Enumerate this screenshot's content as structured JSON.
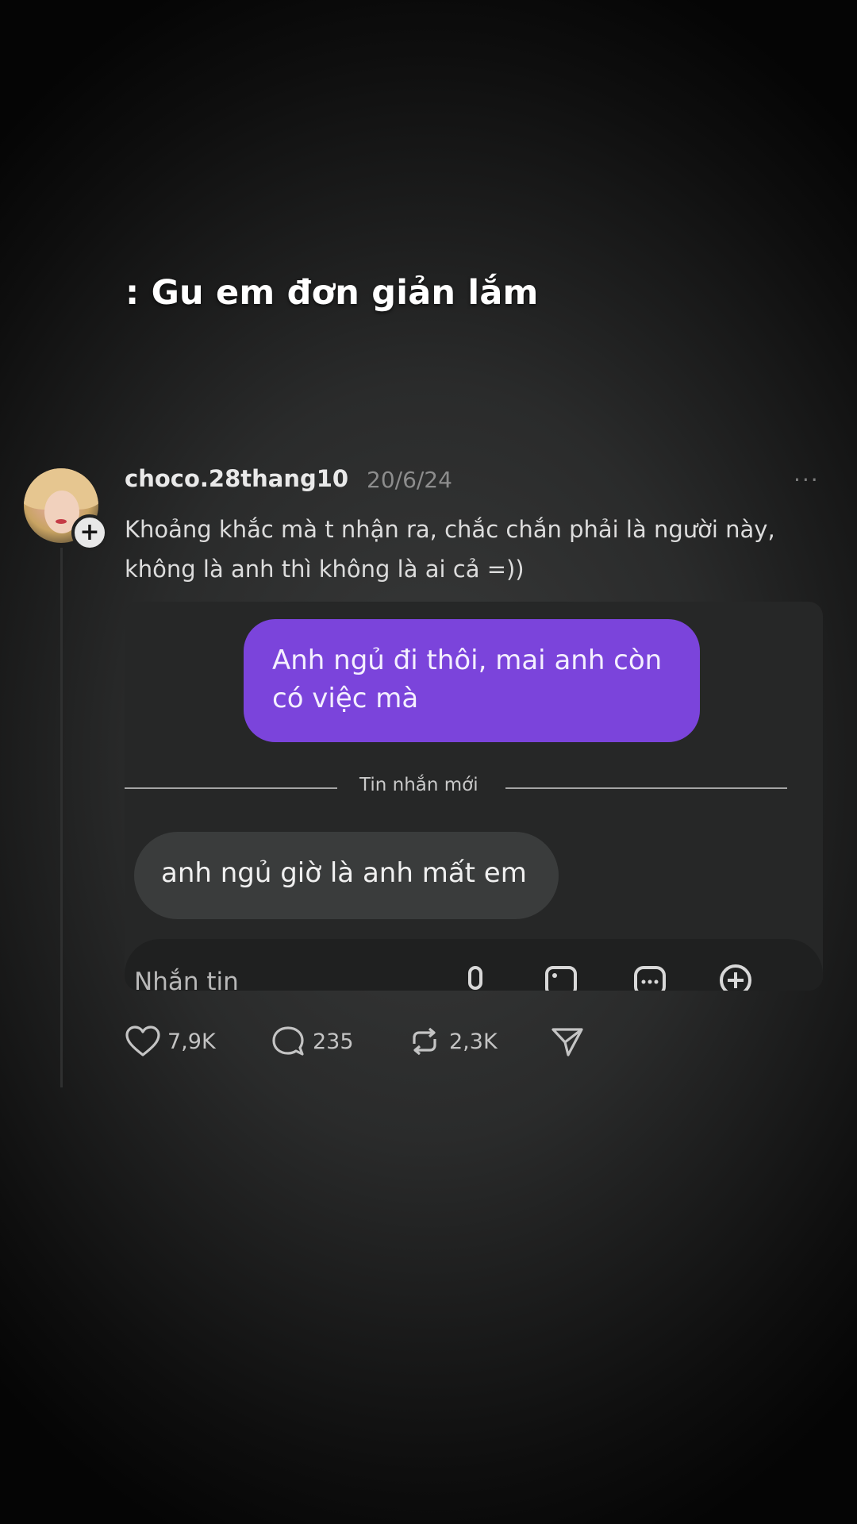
{
  "caption": ": Gu em đơn giản lắm",
  "post": {
    "username": "choco.28thang10",
    "date": "20/6/24",
    "more": "···",
    "text": "Khoảng khắc mà t nhận ra, chắc chắn phải là người này, không là anh thì không là ai cả =))",
    "follow_symbol": "+"
  },
  "chat": {
    "outgoing_message": "Anh ngủ đi thôi, mai anh còn có việc mà",
    "divider_label": "Tin nhắn mới",
    "incoming_message": "anh ngủ giờ là anh mất em",
    "composer_placeholder": "Nhắn tin",
    "composer_icons": [
      "microphone-icon",
      "image-icon",
      "sticker-icon",
      "plus-circle-icon"
    ]
  },
  "actions": {
    "likes": "7,9K",
    "comments": "235",
    "reposts": "2,3K",
    "icons": [
      "heart-icon",
      "comment-icon",
      "repost-icon",
      "share-icon"
    ]
  },
  "colors": {
    "accent_bubble": "#7b44db",
    "incoming_bubble": "#3a3c3c",
    "background": "#2a2b2b"
  }
}
